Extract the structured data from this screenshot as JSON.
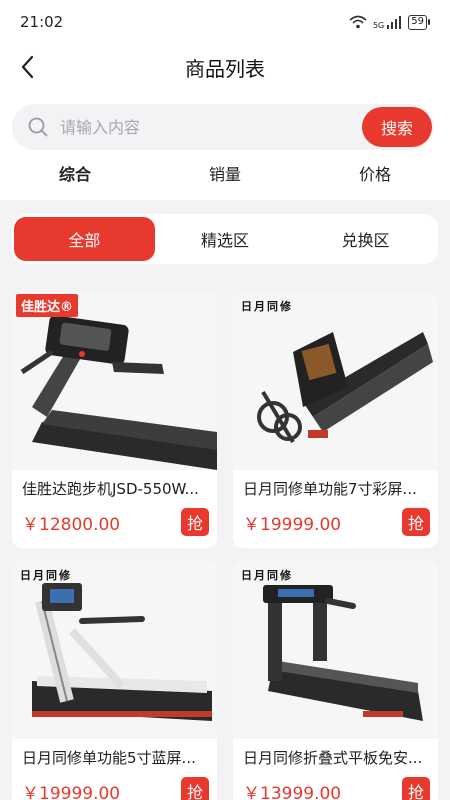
{
  "status": {
    "time": "21:02",
    "network": "5G",
    "battery": "59"
  },
  "nav": {
    "title": "商品列表"
  },
  "search": {
    "placeholder": "请输入内容",
    "button": "搜索"
  },
  "sort_tabs": [
    "综合",
    "销量",
    "价格"
  ],
  "filter_tabs": [
    "全部",
    "精选区",
    "兑换区"
  ],
  "products": [
    {
      "name": "佳胜达跑步机JSD-550W...",
      "price": "￥12800.00",
      "brand": "佳胜达®",
      "action": "抢"
    },
    {
      "name": "日月同修单功能7寸彩屏...",
      "price": "￥19999.00",
      "brand": "日月同修",
      "action": "抢"
    },
    {
      "name": "日月同修单功能5寸蓝屏...",
      "price": "￥19999.00",
      "brand": "日月同修",
      "action": "抢"
    },
    {
      "name": "日月同修折叠式平板免安...",
      "price": "￥13999.00",
      "brand": "日月同修",
      "action": "抢"
    }
  ],
  "colors": {
    "accent": "#e8392f",
    "background": "#f3f3f5"
  }
}
